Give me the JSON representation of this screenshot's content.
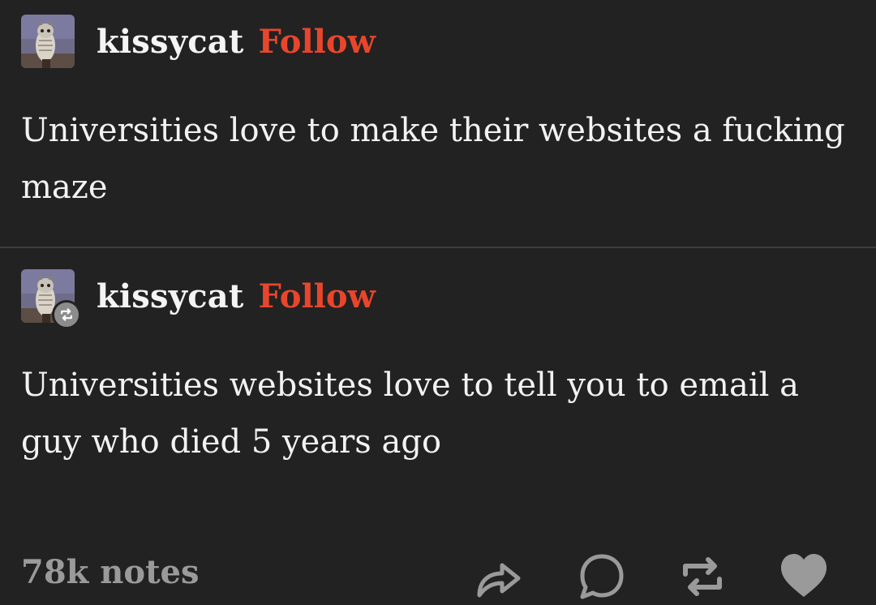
{
  "posts": [
    {
      "username": "kissycat",
      "follow_label": "Follow",
      "avatar_icon": "owl-avatar",
      "text": "Universities love to make their websites a fucking maze"
    },
    {
      "username": "kissycat",
      "follow_label": "Follow",
      "avatar_icon": "owl-avatar",
      "badge_icon": "reblog-icon",
      "text": "Universities websites love to tell you to email a guy who died 5 years ago"
    }
  ],
  "footer": {
    "notes": "78k notes",
    "actions": [
      "share-icon",
      "reply-icon",
      "reblog-icon",
      "heart-icon"
    ]
  },
  "colors": {
    "background": "#222222",
    "follow": "#e8462c",
    "muted": "#9a9a9a",
    "text": "#f2f2f2"
  }
}
